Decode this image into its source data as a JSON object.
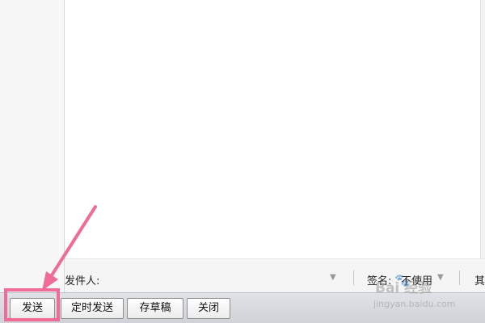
{
  "sender_row": {
    "sender_label": "发件人:",
    "signature_label": "签名:",
    "signature_value": "不使用",
    "more_label": "其"
  },
  "toolbar": {
    "send_label": "发送",
    "scheduled_send_label": "定时发送",
    "save_draft_label": "存草稿",
    "close_label": "关闭"
  },
  "annotation": {
    "highlight_color": "#f06b95"
  },
  "watermark": {
    "text": "Bai 经验",
    "url": "jingyan.baidu.com"
  },
  "icons": {
    "dropdown": "triangle-down-icon",
    "paw": "baidu-paw-icon"
  }
}
